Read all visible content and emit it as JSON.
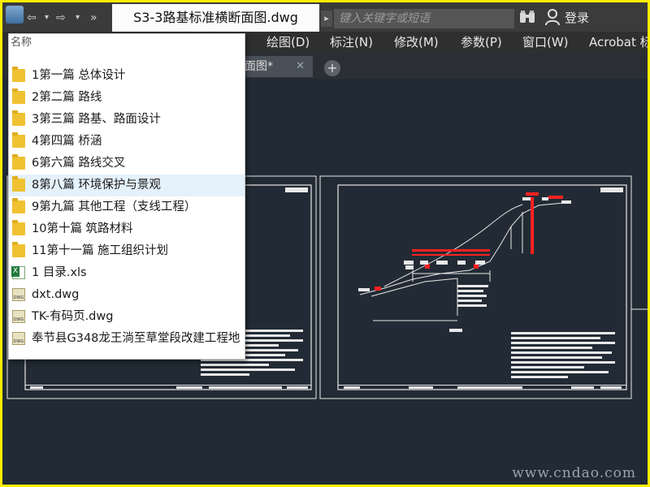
{
  "titlebar": {
    "nav_back": "⇦",
    "nav_forward": "⇨",
    "overflow": "»",
    "document_title": "S3-3路基标准横断面图.dwg",
    "search_placeholder": "键入关键字或短语",
    "login_label": "登录"
  },
  "menubar": {
    "items": [
      {
        "label": ")"
      },
      {
        "label": "绘图(D)"
      },
      {
        "label": "标注(N)"
      },
      {
        "label": "修改(M)"
      },
      {
        "label": "参数(P)"
      },
      {
        "label": "窗口(W)"
      },
      {
        "label": "Acrobat 标"
      }
    ]
  },
  "tabbar": {
    "active_tab": "断面图*",
    "close_glyph": "✕",
    "new_tab_glyph": "+"
  },
  "dropdown": {
    "header": "名称",
    "items": [
      {
        "label": "1第一篇 总体设计",
        "type": "folder"
      },
      {
        "label": "2第二篇  路线",
        "type": "folder"
      },
      {
        "label": "3第三篇 路基、路面设计",
        "type": "folder"
      },
      {
        "label": "4第四篇 桥涵",
        "type": "folder"
      },
      {
        "label": "6第六篇 路线交叉",
        "type": "folder"
      },
      {
        "label": "8第八篇 环境保护与景观",
        "type": "folder",
        "highlighted": true
      },
      {
        "label": "9第九篇 其他工程（支线工程）",
        "type": "folder"
      },
      {
        "label": "10第十篇 筑路材料",
        "type": "folder"
      },
      {
        "label": "11第十一篇 施工组织计划",
        "type": "folder"
      },
      {
        "label": "1 目录.xls",
        "type": "xls"
      },
      {
        "label": "dxt.dwg",
        "type": "dwg"
      },
      {
        "label": "TK-有码页.dwg",
        "type": "dwg"
      },
      {
        "label": "奉节县G348龙王淌至草堂段改建工程地",
        "type": "dwg"
      }
    ]
  },
  "watermark": "www.cndao.com",
  "colors": {
    "border": "#ffee00",
    "canvas": "#222b35",
    "titlebar": "#3b3b3b",
    "menubar": "#2f2f2f",
    "drawing_lines": "#ffffff",
    "drawing_accent": "#ff2020"
  }
}
